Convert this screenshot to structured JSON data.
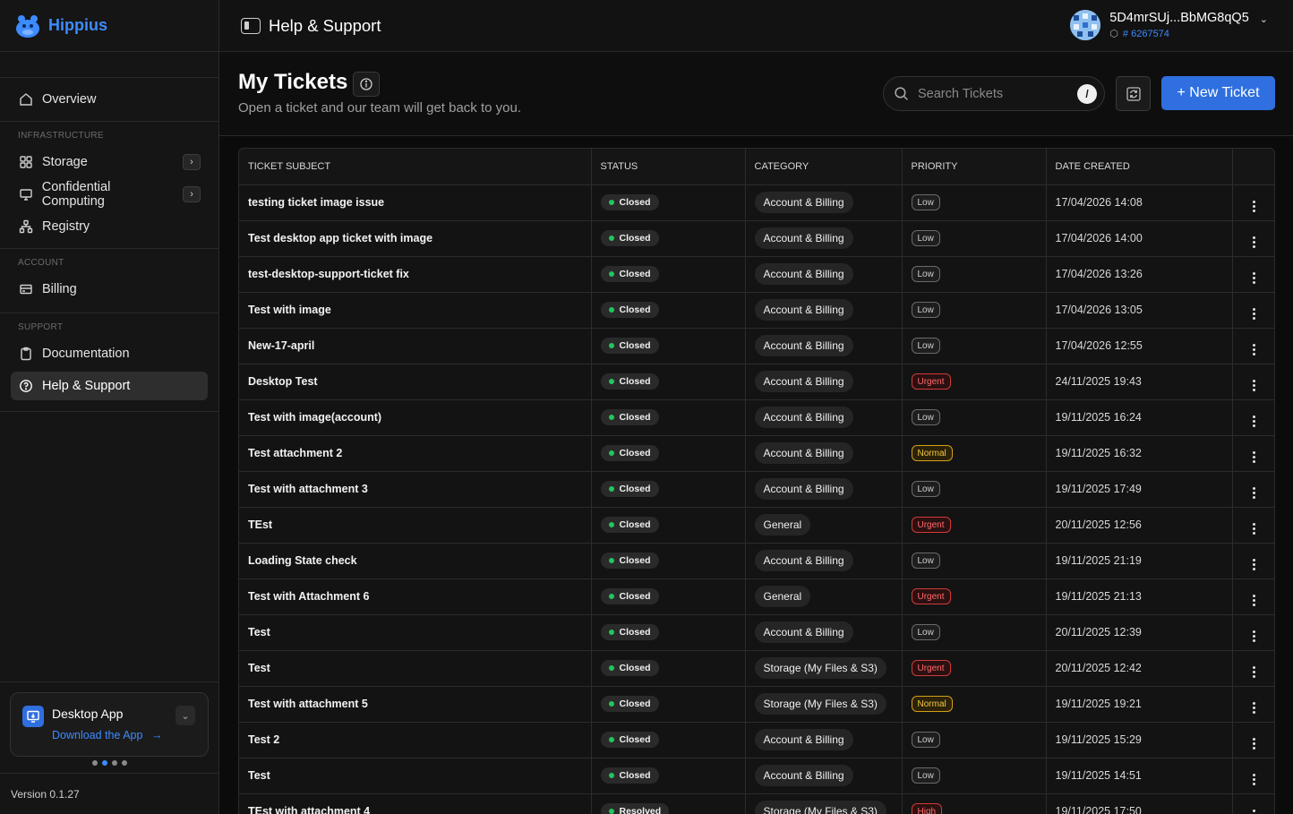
{
  "brand": {
    "name": "Hippius"
  },
  "sidebar": {
    "overview": "Overview",
    "infrastructure_label": "INFRASTRUCTURE",
    "storage": "Storage",
    "confidential": "Confidential Computing",
    "registry": "Registry",
    "account_label": "ACCOUNT",
    "billing": "Billing",
    "support_label": "SUPPORT",
    "documentation": "Documentation",
    "help": "Help & Support",
    "desktop_title": "Desktop App",
    "desktop_link": "Download the App",
    "version": "Version 0.1.27"
  },
  "topbar": {
    "title": "Help & Support",
    "user_name": "5D4mrSUj...BbMG8qQ5",
    "user_id": "# 6267574"
  },
  "page": {
    "title": "My Tickets",
    "subtitle": "Open a ticket and our team will get back to you.",
    "search_placeholder": "Search Tickets",
    "search_shortcut": "/",
    "new_ticket": "+ New Ticket"
  },
  "table": {
    "headers": [
      "TICKET SUBJECT",
      "STATUS",
      "CATEGORY",
      "PRIORITY",
      "DATE CREATED"
    ],
    "rows": [
      {
        "subject": "testing ticket image issue",
        "status": "Closed",
        "category": "Account & Billing",
        "priority": "Low",
        "date": "17/04/2026 14:08"
      },
      {
        "subject": "Test desktop app ticket with image",
        "status": "Closed",
        "category": "Account & Billing",
        "priority": "Low",
        "date": "17/04/2026 14:00"
      },
      {
        "subject": "test-desktop-support-ticket fix",
        "status": "Closed",
        "category": "Account & Billing",
        "priority": "Low",
        "date": "17/04/2026 13:26"
      },
      {
        "subject": "Test with image",
        "status": "Closed",
        "category": "Account & Billing",
        "priority": "Low",
        "date": "17/04/2026 13:05"
      },
      {
        "subject": "New-17-april",
        "status": "Closed",
        "category": "Account & Billing",
        "priority": "Low",
        "date": "17/04/2026 12:55"
      },
      {
        "subject": "Desktop Test",
        "status": "Closed",
        "category": "Account & Billing",
        "priority": "Urgent",
        "date": "24/11/2025 19:43"
      },
      {
        "subject": "Test with image(account)",
        "status": "Closed",
        "category": "Account & Billing",
        "priority": "Low",
        "date": "19/11/2025 16:24"
      },
      {
        "subject": "Test attachment 2",
        "status": "Closed",
        "category": "Account & Billing",
        "priority": "Normal",
        "date": "19/11/2025 16:32"
      },
      {
        "subject": "Test with attachment 3",
        "status": "Closed",
        "category": "Account & Billing",
        "priority": "Low",
        "date": "19/11/2025 17:49"
      },
      {
        "subject": "TEst",
        "status": "Closed",
        "category": "General",
        "priority": "Urgent",
        "date": "20/11/2025 12:56"
      },
      {
        "subject": "Loading State check",
        "status": "Closed",
        "category": "Account & Billing",
        "priority": "Low",
        "date": "19/11/2025 21:19"
      },
      {
        "subject": "Test with Attachment 6",
        "status": "Closed",
        "category": "General",
        "priority": "Urgent",
        "date": "19/11/2025 21:13"
      },
      {
        "subject": "Test",
        "status": "Closed",
        "category": "Account & Billing",
        "priority": "Low",
        "date": "20/11/2025 12:39"
      },
      {
        "subject": "Test",
        "status": "Closed",
        "category": "Storage (My Files & S3)",
        "priority": "Urgent",
        "date": "20/11/2025 12:42"
      },
      {
        "subject": "Test with attachment 5",
        "status": "Closed",
        "category": "Storage (My Files & S3)",
        "priority": "Normal",
        "date": "19/11/2025 19:21"
      },
      {
        "subject": "Test 2",
        "status": "Closed",
        "category": "Account & Billing",
        "priority": "Low",
        "date": "19/11/2025 15:29"
      },
      {
        "subject": "Test",
        "status": "Closed",
        "category": "Account & Billing",
        "priority": "Low",
        "date": "19/11/2025 14:51"
      },
      {
        "subject": "TEst with attachment 4",
        "status": "Resolved",
        "category": "Storage (My Files & S3)",
        "priority": "High",
        "date": "19/11/2025 17:50"
      }
    ]
  },
  "colors": {
    "accent": "#2f6fe0",
    "link": "#3d8bff",
    "status_ok": "#22c55e"
  }
}
